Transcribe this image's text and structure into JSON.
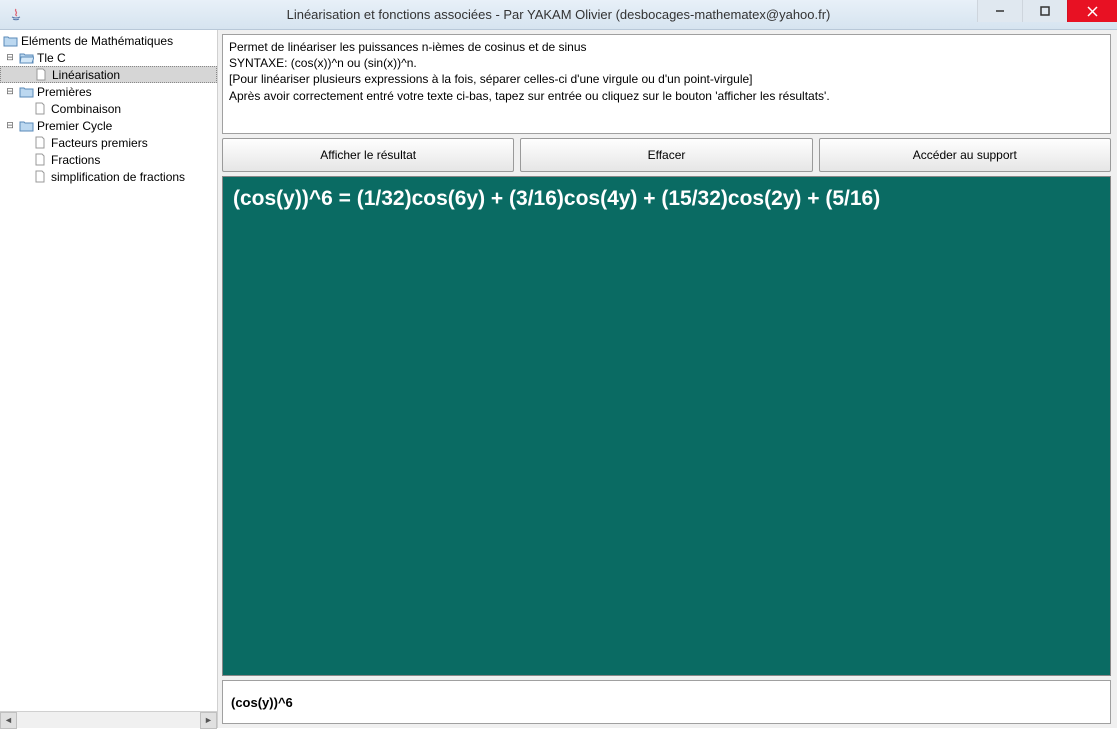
{
  "window": {
    "title": "Linéarisation et fonctions associées - Par YAKAM Olivier (desbocages-mathematex@yahoo.fr)"
  },
  "tree": {
    "root_label": "Eléments de Mathématiques",
    "nodes": [
      {
        "label": "Tle C",
        "children": [
          {
            "label": "Linéarisation",
            "selected": true
          }
        ]
      },
      {
        "label": "Premières",
        "children": [
          {
            "label": "Combinaison"
          }
        ]
      },
      {
        "label": "Premier Cycle",
        "children": [
          {
            "label": "Facteurs premiers"
          },
          {
            "label": "Fractions"
          },
          {
            "label": "simplification de fractions"
          }
        ]
      }
    ]
  },
  "description": {
    "line1": "Permet de linéariser les puissances n-ièmes de cosinus et de sinus",
    "line2": "SYNTAXE: (cos(x))^n ou (sin(x))^n.",
    "line3": "[Pour linéariser plusieurs expressions à la fois, séparer celles-ci d'une virgule ou d'un point-virgule]",
    "line4": "Après avoir correctement entré votre texte ci-bas, tapez sur entrée ou cliquez sur le bouton 'afficher les résultats'."
  },
  "buttons": {
    "show_result": "Afficher le résultat",
    "clear": "Effacer",
    "support": "Accéder au support"
  },
  "result": {
    "text": "(cos(y))^6 = (1/32)cos(6y) + (3/16)cos(4y) + (15/32)cos(2y) + (5/16)"
  },
  "input": {
    "value": "(cos(y))^6"
  }
}
